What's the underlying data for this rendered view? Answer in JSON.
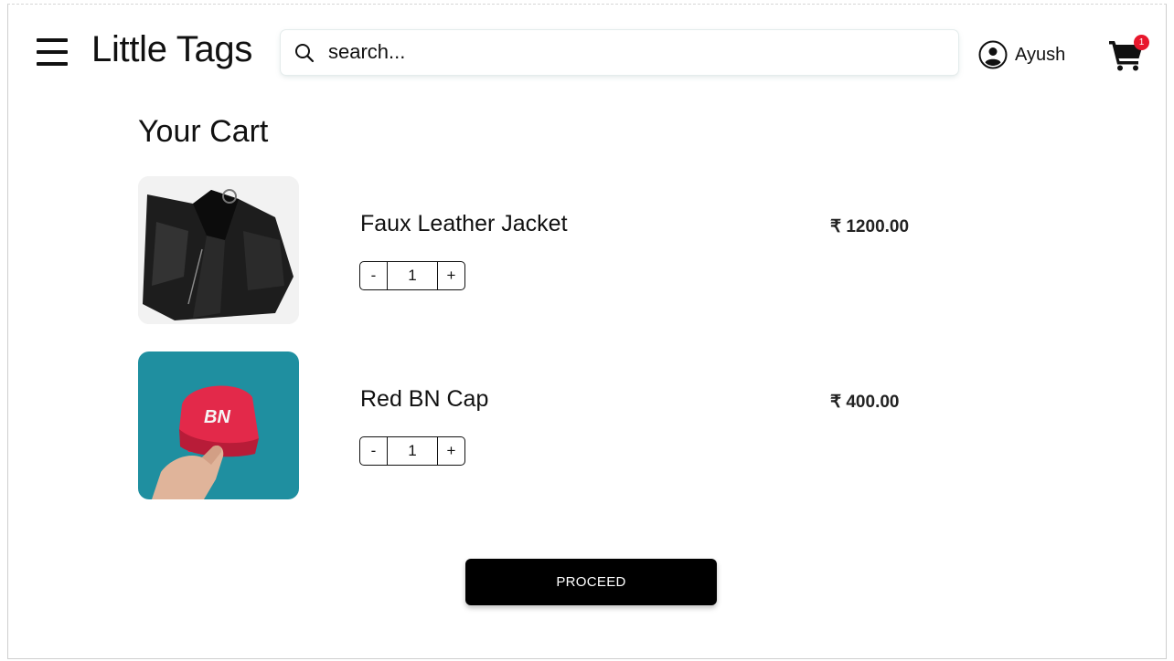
{
  "header": {
    "brand": "Little Tags",
    "search_placeholder": "search...",
    "user_name": "Ayush",
    "cart_count": "1"
  },
  "cart": {
    "title": "Your Cart",
    "items": [
      {
        "name": "Faux Leather Jacket",
        "price": "₹ 1200.00",
        "quantity": "1",
        "dec_label": "-",
        "inc_label": "+",
        "image": "leather-jacket-photo"
      },
      {
        "name": "Red BN Cap",
        "price": "₹ 400.00",
        "quantity": "1",
        "dec_label": "-",
        "inc_label": "+",
        "image": "red-cap-photo"
      }
    ],
    "proceed_label": "PROCEED"
  },
  "icons": [
    "menu-icon",
    "search-icon",
    "user-icon",
    "cart-icon"
  ],
  "colors": {
    "accent": "#000000",
    "badge": "#e8172c",
    "cap_background": "#1f8fa0"
  }
}
